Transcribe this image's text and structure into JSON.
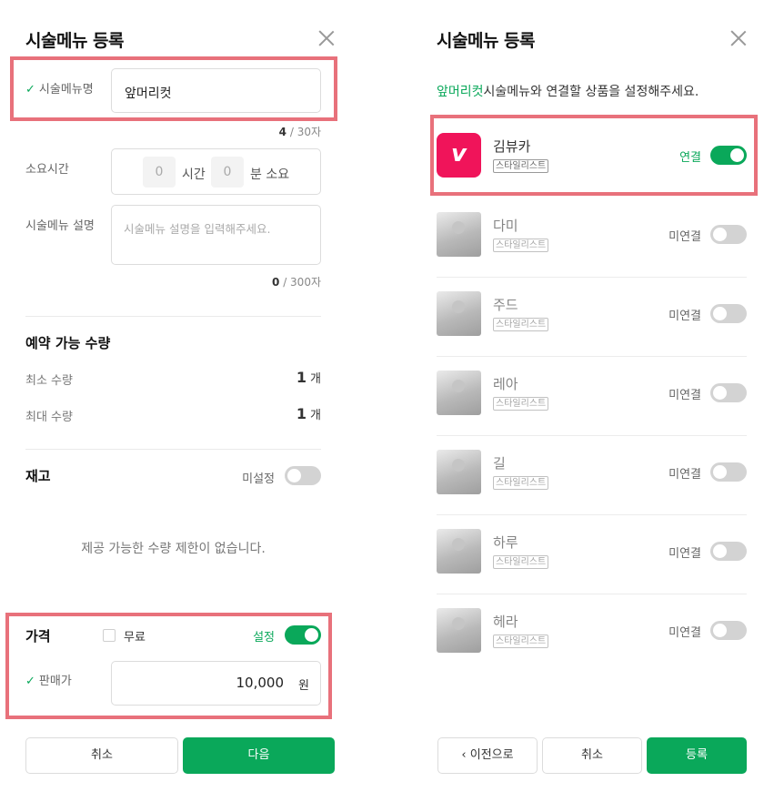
{
  "left": {
    "title": "시술메뉴 등록",
    "menu_name_label": "시술메뉴명",
    "menu_name_value": "앞머리컷",
    "menu_name_count": "4",
    "menu_name_max": " / 30자",
    "duration_label": "소요시간",
    "duration_hours": "0",
    "duration_hours_unit": "시간",
    "duration_minutes": "0",
    "duration_minutes_unit": "분 소요",
    "description_label": "시술메뉴 설명",
    "description_placeholder": "시술메뉴 설명을 입력해주세요.",
    "description_count": "0",
    "description_max": " / 300자",
    "reservation_title": "예약 가능 수량",
    "min_qty_label": "최소 수량",
    "min_qty_value": "1",
    "max_qty_label": "최대 수량",
    "max_qty_value": "1",
    "qty_unit": "개",
    "stock_title": "재고",
    "stock_toggle_text": "미설정",
    "stock_toggle_on": false,
    "stock_empty_message": "제공 가능한 수량 제한이 없습니다.",
    "price_title": "가격",
    "free_label": "무료",
    "price_toggle_text": "설정",
    "price_toggle_on": true,
    "sale_price_label": "판매가",
    "sale_price_value": "10,000",
    "currency_unit": "원",
    "cancel_button": "취소",
    "next_button": "다음"
  },
  "right": {
    "title": "시술메뉴 등록",
    "subtitle_accent": "앞머리컷",
    "subtitle_rest": "시술메뉴와 연결할 상품을 설정해주세요.",
    "products": [
      {
        "name": "김뷰카",
        "badge": "스타일리스트",
        "status": "연결",
        "connected": true,
        "thumb": "logo-icon"
      },
      {
        "name": "다미",
        "badge": "스타일리스트",
        "status": "미연결",
        "connected": false,
        "thumb": "photo"
      },
      {
        "name": "주드",
        "badge": "스타일리스트",
        "status": "미연결",
        "connected": false,
        "thumb": "photo"
      },
      {
        "name": "레아",
        "badge": "스타일리스트",
        "status": "미연결",
        "connected": false,
        "thumb": "photo"
      },
      {
        "name": "길",
        "badge": "스타일리스트",
        "status": "미연결",
        "connected": false,
        "thumb": "photo"
      },
      {
        "name": "하루",
        "badge": "스타일리스트",
        "status": "미연결",
        "connected": false,
        "thumb": "photo"
      },
      {
        "name": "헤라",
        "badge": "스타일리스트",
        "status": "미연결",
        "connected": false,
        "thumb": "photo"
      }
    ],
    "prev_button": "이전으로",
    "cancel_button": "취소",
    "register_button": "등록"
  },
  "colors": {
    "accent": "#0aa85a",
    "highlight": "#e8717b",
    "logo": "#f0145a"
  }
}
